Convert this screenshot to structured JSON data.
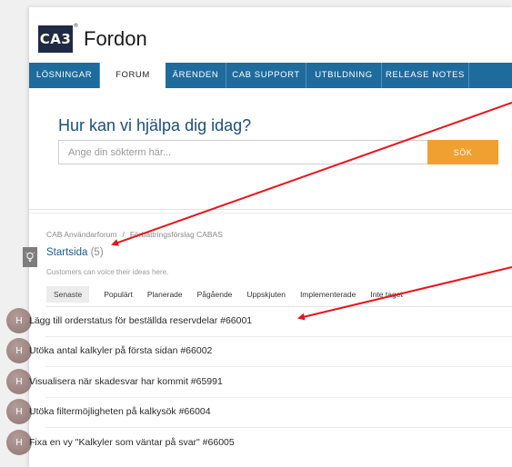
{
  "brand": {
    "logo_text": "CA3",
    "logo_mark": "®",
    "name": "Fordon"
  },
  "nav": [
    {
      "label": "LÖSNINGAR",
      "active": false
    },
    {
      "label": "FORUM",
      "active": true
    },
    {
      "label": "ÄRENDEN",
      "active": false
    },
    {
      "label": "CAB SUPPORT",
      "active": false
    },
    {
      "label": "UTBILDNING",
      "active": false
    },
    {
      "label": "RELEASE NOTES",
      "active": false
    }
  ],
  "help": {
    "title": "Hur kan vi hjälpa dig idag?",
    "search_placeholder": "Ange din sökterm här...",
    "search_value": "",
    "search_button": "SÖK"
  },
  "breadcrumb": {
    "items": [
      "CAB Användarforum",
      "Förbättringsförslag CABAS"
    ],
    "separator": "/"
  },
  "forum": {
    "title": "Startsida",
    "count": "(5)",
    "subtitle": "Customers can voice their ideas here.",
    "filters": [
      "Senaste",
      "Populärt",
      "Planerade",
      "Pågående",
      "Uppskjuten",
      "Implementerade",
      "Inte taget"
    ],
    "active_filter": "Senaste"
  },
  "ideas": [
    {
      "avatar": "H",
      "title": "Lägg till orderstatus för beställda reservdelar #66001"
    },
    {
      "avatar": "H",
      "title": "Utöka antal kalkyler på första sidan #66002"
    },
    {
      "avatar": "H",
      "title": "Visualisera när skadesvar har kommit #65991"
    },
    {
      "avatar": "H",
      "title": "Utöka filtermöjligheten på kalkysök #66004"
    },
    {
      "avatar": "H",
      "title": "Fixa en vy \"Kalkyler som väntar på svar\" #66005"
    }
  ],
  "colors": {
    "nav": "#1e6b9e",
    "accent": "#f0a030",
    "link": "#1b5a8e",
    "arrow": "#e8141c"
  }
}
